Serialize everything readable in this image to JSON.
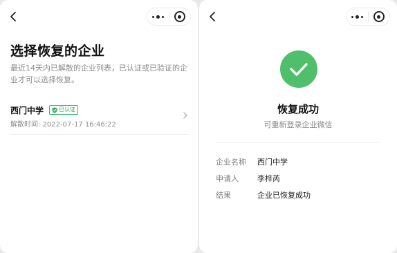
{
  "left": {
    "title": "选择恢复的企业",
    "description": "最近14天内已解散的企业列表，已认证或已验证的企业才可以选择恢复。",
    "company": {
      "name": "西门中学",
      "badge": "已认证",
      "dissolve_label": "解散时间:",
      "dissolve_time": "2022-07-17 16:46:22"
    }
  },
  "right": {
    "title": "恢复成功",
    "subtitle": "可重新登录企业微信",
    "info": [
      {
        "label": "企业名称",
        "value": "西门中学"
      },
      {
        "label": "申请人",
        "value": "李梓芮"
      },
      {
        "label": "结果",
        "value": "企业已恢复成功"
      }
    ]
  },
  "colors": {
    "success": "#4fbf6b",
    "badge_green": "#2fa55a",
    "secondary_text": "#8c8c8c"
  },
  "icons": {
    "back": "chevron-left-icon",
    "more": "more-dots-icon",
    "close_miniapp": "target-icon",
    "success": "check-circle-icon",
    "verified": "shield-check-icon",
    "row_arrow": "chevron-right-icon"
  }
}
